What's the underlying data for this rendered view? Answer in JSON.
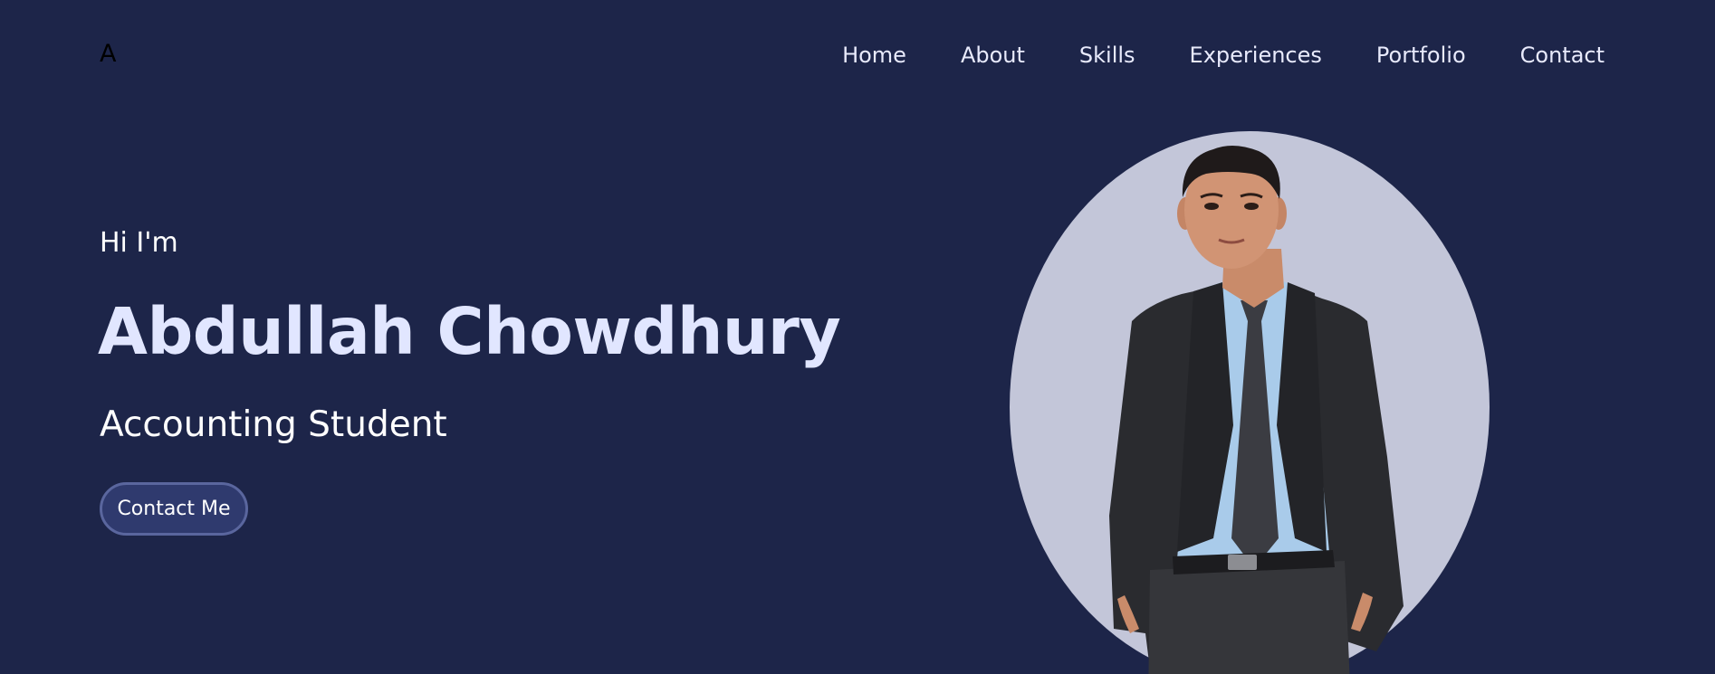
{
  "header": {
    "logo": "A",
    "nav": [
      {
        "label": "Home"
      },
      {
        "label": "About"
      },
      {
        "label": "Skills"
      },
      {
        "label": "Experiences"
      },
      {
        "label": "Portfolio"
      },
      {
        "label": "Contact"
      }
    ]
  },
  "hero": {
    "greeting": "Hi I'm",
    "name": "Abdullah Chowdhury",
    "role": "Accounting Student",
    "cta_label": "Contact Me"
  },
  "colors": {
    "background": "#1d2549",
    "name_text": "#e1e6ff",
    "nav_text": "#e8eafc",
    "button_bg": "#2f3a6e",
    "button_border": "#5a669e",
    "portrait_oval": "#c3c6d9"
  },
  "icons": {
    "portrait": "profile-photo"
  }
}
